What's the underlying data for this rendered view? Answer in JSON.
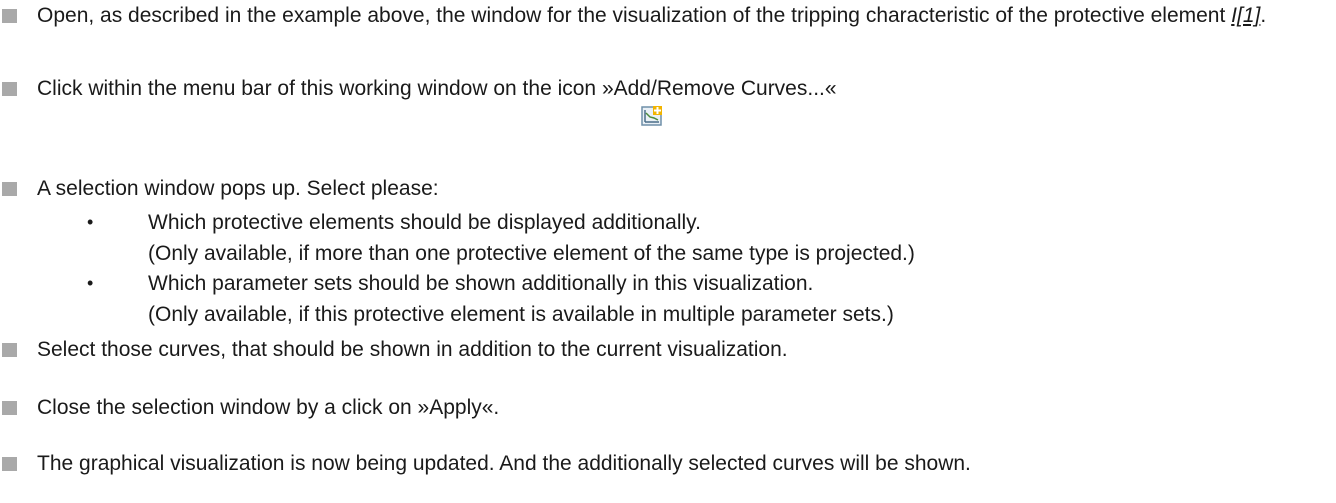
{
  "steps": [
    {
      "text_a": "Open, as described in the example above, the window for the visualization of the tripping characteristic of the protective element ",
      "ref": "I[1]",
      "text_b": "."
    },
    {
      "text": "Click within the menu bar of this working window on the icon »Add/Remove Curves...«"
    },
    {
      "text": "A selection window pops up. Select please:"
    },
    {
      "text": "Select those curves, that should be shown in addition to the current visualization."
    },
    {
      "text": "Close the selection window by a click on »Apply«."
    },
    {
      "text": "The graphical visualization is now being updated. And the additionally selected curves will be shown."
    }
  ],
  "sub_items": [
    {
      "bullet": "•",
      "line1": "Which protective elements should be displayed additionally.",
      "line2": "(Only available, if more than one protective element of the same type is projected.)"
    },
    {
      "bullet": "•",
      "line1": "Which parameter sets should be shown additionally in this visualization.",
      "line2": "(Only available, if this protective element is available in multiple parameter sets.)"
    }
  ],
  "icons": {
    "add_remove_curves": "add-remove-curves-icon",
    "bullet": "square-bullet"
  },
  "colors": {
    "text": "#1a1a1a",
    "bullet": "#a9a9a9",
    "icon_frame": "#6f8fa8",
    "icon_plus": "#f2b400"
  }
}
